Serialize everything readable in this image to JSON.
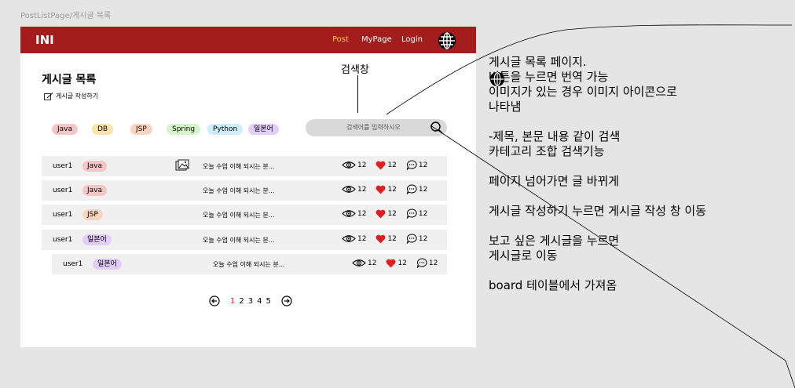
{
  "frame_label": "PostListPage/게시글 목록",
  "app": {
    "logo": "INI",
    "nav": [
      "Post",
      "MyPage",
      "Login"
    ],
    "active_nav": "Post"
  },
  "page": {
    "title": "게시글 목록",
    "write_label": "게시글 작성하기"
  },
  "categories": [
    {
      "label": "Java",
      "color": "#f4c6c6"
    },
    {
      "label": "DB",
      "color": "#fde3a7"
    },
    {
      "label": "JSP",
      "color": "#fcd5c0"
    },
    {
      "label": "Spring",
      "color": "#d4f5c9"
    },
    {
      "label": "Python",
      "color": "#cdeefc"
    },
    {
      "label": "일본어",
      "color": "#e3cdfa"
    }
  ],
  "search": {
    "placeholder": "검색어를 입력하시오"
  },
  "posts": [
    {
      "user": "user1",
      "category": "Java",
      "cat_color": "#f4c6c6",
      "title": "오늘 수업 이해 되시는 분...",
      "has_image": true,
      "views": "12",
      "likes": "12",
      "comments": "12"
    },
    {
      "user": "user1",
      "category": "Java",
      "cat_color": "#f4c6c6",
      "title": "오늘 수업 이해 되시는 분...",
      "has_image": false,
      "views": "12",
      "likes": "12",
      "comments": "12"
    },
    {
      "user": "user1",
      "category": "JSP",
      "cat_color": "#fcd5c0",
      "title": "오늘 수업 이해 되시는 분...",
      "has_image": false,
      "views": "12",
      "likes": "12",
      "comments": "12"
    },
    {
      "user": "user1",
      "category": "일본어",
      "cat_color": "#e3cdfa",
      "title": "오늘 수업 이해 되시는 분...",
      "has_image": false,
      "views": "12",
      "likes": "12",
      "comments": "12"
    },
    {
      "user": "user1",
      "category": "일본어",
      "cat_color": "#e3cdfa",
      "title": "오늘 수업 이해 되시는 분...",
      "has_image": false,
      "views": "12",
      "likes": "12",
      "comments": "12"
    }
  ],
  "pagination": {
    "pages": [
      "1",
      "2",
      "3",
      "4",
      "5"
    ],
    "current": "1"
  },
  "annotation": {
    "search_label": "검색창",
    "notes_text": "게시글 목록 페이지.\n    버튼을 누르면 번역  가능\n이미지가 있는 경우 이미지 아이콘으로\n나타냄\n\n-제목, 본문 내용 같이 검색\n카테고리 조합 검색기능\n\n페이지 넘어가면 글 바뀌게\n\n게시글 작성하기 누르면 게시글 작성 창 이동\n\n보고 싶은 게시글을 누르면\n게시글로 이동\n\nboard 테이블에서 가져옴"
  },
  "colors": {
    "topbar": "#a51c1c",
    "active_nav": "#ffcc33",
    "heart": "#e02020"
  },
  "icons": [
    "globe-icon",
    "pencil-note-icon",
    "search-icon",
    "image-icon",
    "eye-icon",
    "heart-icon",
    "comment-icon",
    "arrow-left-circle-icon",
    "arrow-right-circle-icon"
  ]
}
